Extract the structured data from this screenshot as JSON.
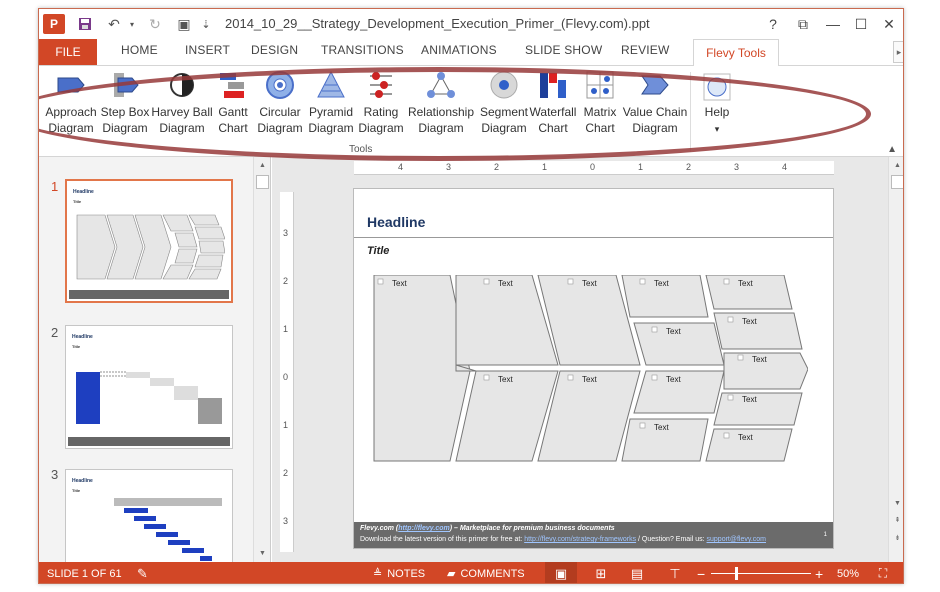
{
  "window": {
    "title": "2014_10_29__Strategy_Development_Execution_Primer_(Flevy.com).ppt",
    "app_logo": "P",
    "buttons": {
      "help": "?",
      "restore_ribbon": "⧉",
      "minimize": "—",
      "maximize": "☐",
      "close": "✕"
    }
  },
  "quick_access": {
    "save_icon": "💾",
    "undo_icon": "↶",
    "redo_icon": "↻",
    "present_icon": "▣",
    "customize": "⇣"
  },
  "tabs": {
    "file": "FILE",
    "items": [
      "HOME",
      "INSERT",
      "DESIGN",
      "TRANSITIONS",
      "ANIMATIONS",
      "SLIDE SHOW",
      "REVIEW"
    ],
    "active": "Flevy Tools",
    "scroll": "▸"
  },
  "ribbon": {
    "group_label": "Tools",
    "collapse": "▲",
    "buttons": [
      {
        "l1": "Approach",
        "l2": "Diagram"
      },
      {
        "l1": "Step Box",
        "l2": "Diagram"
      },
      {
        "l1": "Harvey Ball",
        "l2": "Diagram"
      },
      {
        "l1": "Gantt",
        "l2": "Chart"
      },
      {
        "l1": "Circular",
        "l2": "Diagram"
      },
      {
        "l1": "Pyramid",
        "l2": "Diagram"
      },
      {
        "l1": "Rating",
        "l2": "Diagram"
      },
      {
        "l1": "Relationship",
        "l2": "Diagram"
      },
      {
        "l1": "Segment",
        "l2": "Diagram"
      },
      {
        "l1": "Waterfall",
        "l2": "Chart"
      },
      {
        "l1": "Matrix",
        "l2": "Chart"
      },
      {
        "l1": "Value Chain",
        "l2": "Diagram"
      }
    ],
    "help": {
      "label": "Help",
      "arrow": "▾"
    }
  },
  "thumbnails": [
    {
      "num": "1",
      "headline": "Headline",
      "title": "Title"
    },
    {
      "num": "2",
      "headline": "Headline",
      "title": "Title"
    },
    {
      "num": "3",
      "headline": "Headline",
      "title": "Title"
    }
  ],
  "slide": {
    "headline": "Headline",
    "title": "Title",
    "box_text": "Text",
    "footer": {
      "brand": "Flevy.com",
      "brand_open": " (",
      "brand_link": "http://flevy.com",
      "brand_close": ") – Marketplace for premium business documents",
      "line2_prefix": "Download the latest version of this primer for free at: ",
      "line2_link": "http://flevy.com/strategy-frameworks",
      "line2_mid": "  /  Question? Email us: ",
      "email": "support@flevy.com"
    },
    "page_number": "1"
  },
  "ruler": {
    "h": [
      "4",
      "3",
      "2",
      "1",
      "0",
      "1",
      "2",
      "3",
      "4"
    ],
    "v": [
      "3",
      "2",
      "1",
      "0",
      "1",
      "2",
      "3"
    ]
  },
  "statusbar": {
    "slide_info": "SLIDE 1 OF 61",
    "notes": "NOTES",
    "comments": "COMMENTS",
    "zoom_minus": "−",
    "zoom_plus": "+",
    "zoom": "50%"
  },
  "colors": {
    "accent": "#d24726",
    "headline": "#1f3864",
    "ellipse": "#963a3a"
  }
}
